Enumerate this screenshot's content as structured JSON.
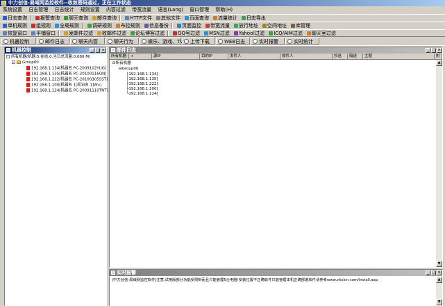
{
  "window": {
    "title": "中力创信-局域网监控软件--收敛密码通过，正在工作状态"
  },
  "menu": [
    "系统设置",
    "日志管理",
    "日志统计",
    "规则设置",
    "内容过滤",
    "带宽流量",
    "语言(Lang)",
    "窗口管理",
    "帮助(H)"
  ],
  "toolbar1": [
    {
      "label": "日志查询",
      "icon": "log-query-icon",
      "color": "#3060c0"
    },
    {
      "label": "报警查询",
      "icon": "alarm-query-icon",
      "color": "#d03030"
    },
    {
      "label": "聊天查询",
      "icon": "chat-query-icon",
      "color": "#30a030"
    },
    {
      "label": "邮件查询",
      "icon": "mail-query-icon",
      "color": "#d0a030"
    },
    {
      "label": "HTTP文件",
      "icon": "http-file-icon",
      "color": "#6080c0"
    },
    {
      "label": "其他文件",
      "icon": "other-file-icon",
      "color": "#808080"
    },
    {
      "label": "页面查询",
      "icon": "page-query-icon",
      "color": "#3090d0"
    },
    {
      "label": "流量统计",
      "icon": "traffic-stats-icon",
      "color": "#c08030"
    },
    {
      "label": "日志导出",
      "icon": "log-export-icon",
      "color": "#40a060"
    }
  ],
  "toolbar2": [
    {
      "label": "单机规则",
      "icon": "single-rule-icon",
      "color": "#3060c0"
    },
    {
      "label": "组规则",
      "icon": "group-rule-icon",
      "color": "#c03030"
    },
    {
      "label": "全局规则",
      "icon": "global-rule-icon",
      "color": "#3090d0"
    },
    {
      "label": "调研规则",
      "icon": "survey-rule-icon",
      "color": "#40a040"
    },
    {
      "label": "布控规则",
      "icon": "deploy-rule-icon",
      "color": "#d08030"
    },
    {
      "label": "信息备份",
      "icon": "backup-icon",
      "color": "#6060a0"
    },
    {
      "label": "页面监控",
      "icon": "page-monitor-icon",
      "color": "#3080c0"
    },
    {
      "label": "带宽流量",
      "icon": "bandwidth-icon",
      "color": "#c04040"
    },
    {
      "label": "放行地址",
      "icon": "allow-address-icon",
      "color": "#40a060"
    },
    {
      "label": "空间地址",
      "icon": "space-address-icon",
      "color": "#a08030"
    },
    {
      "label": "库管理",
      "icon": "library-icon",
      "color": "#806040"
    }
  ],
  "toolbar3": [
    {
      "label": "恢复窗口",
      "icon": "restore-window-icon",
      "color": "#6080c0"
    },
    {
      "label": "平铺窗口",
      "icon": "tile-window-icon",
      "color": "#6080c0"
    },
    {
      "label": "发邮件过滤",
      "icon": "send-mail-filter-icon",
      "color": "#d0a030"
    },
    {
      "label": "收邮件过滤",
      "icon": "receive-mail-filter-icon",
      "color": "#d0a030"
    },
    {
      "label": "论坛博客过滤",
      "icon": "forum-filter-icon",
      "color": "#40a040"
    },
    {
      "label": "QQ号过滤",
      "icon": "qq-filter-icon",
      "color": "#c03030"
    },
    {
      "label": "MSN过滤",
      "icon": "msn-filter-icon",
      "color": "#3090d0"
    },
    {
      "label": "Yahoo!过滤",
      "icon": "yahoo-filter-icon",
      "color": "#8040a0"
    },
    {
      "label": "ICQ/AIM过滤",
      "icon": "icq-filter-icon",
      "color": "#40a040"
    },
    {
      "label": "聊天室过滤",
      "icon": "chatroom-filter-icon",
      "color": "#d08030"
    }
  ],
  "tabs": [
    "机器控制",
    "邮件日志",
    "聊天内容",
    "聊天行为",
    "娱乐、游戏、TV",
    "上传下载",
    "WEB日志",
    "实时报警",
    "实时统计"
  ],
  "left_panel": {
    "title": "机器控制",
    "root_label": "所有机器(机器:5,在线:0,当日总流量:0.000 M)",
    "group_label": "Group00",
    "machines": [
      "192.168.1.134[机器名 PC-2009102YUG]",
      "192.168.1.135[机器名 PC-20100116QN]",
      "192.168.1.222[机器名 PC-20100305SST]",
      "192.168.1.100[机器名 1[标记名 1]Wu]",
      "192.168.1.124[机器名 PC-20091110TNT]"
    ]
  },
  "mail_panel": {
    "title": "邮件日志",
    "columns": [
      "所有机器",
      "+",
      "源IP",
      "目的IP",
      "发件人",
      "收件人",
      "抄送",
      "暗送",
      "主题",
      "附"
    ],
    "root_label": "所有机器",
    "group_label": "Group00",
    "machines": [
      "192.168.1.134[",
      "192.168.1.135[",
      "192.168.1.222[",
      "192.168.1.100[",
      "192.168.1.124["
    ]
  },
  "alarm_panel": {
    "title": "实时报警",
    "message": "[中力创信-局域网监控软件]注意,试用版部分功能受限制而且只能管理5台电脑!安装位置不正确软件只能管理本机正确部署软件请参考www.zhxlcn.com/install.asp;"
  },
  "window_buttons": {
    "minimize": "_",
    "maximize": "□",
    "close": "×"
  }
}
